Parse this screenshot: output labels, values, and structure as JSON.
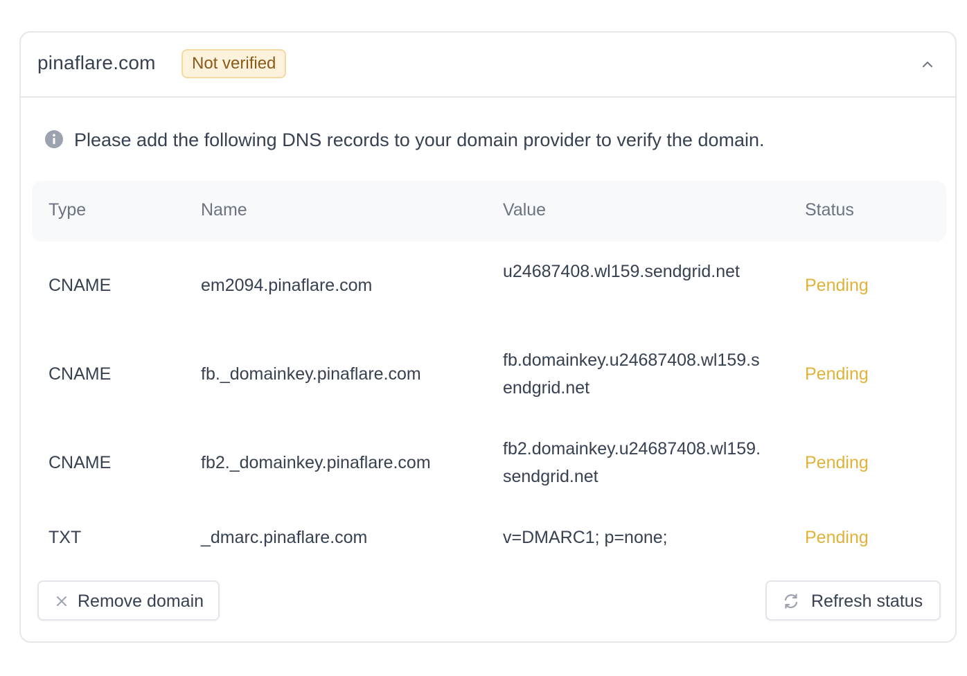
{
  "domain": {
    "name": "pinaflare.com",
    "status_badge": "Not verified"
  },
  "notice": {
    "icon": "info-icon",
    "text": "Please add the following DNS records to your domain provider to verify the domain."
  },
  "table": {
    "columns": [
      "Type",
      "Name",
      "Value",
      "Status"
    ],
    "rows": [
      {
        "type": "CNAME",
        "name": "em2094.pinaflare.com",
        "value": "u24687408.wl159.sendgrid.net",
        "status": "Pending"
      },
      {
        "type": "CNAME",
        "name": "fb._domainkey.pinaflare.com",
        "value": "fb.domainkey.u24687408.wl159.sendgrid.net",
        "status": "Pending"
      },
      {
        "type": "CNAME",
        "name": "fb2._domainkey.pinaflare.com",
        "value": "fb2.domainkey.u24687408.wl159.sendgrid.net",
        "status": "Pending"
      },
      {
        "type": "TXT",
        "name": "_dmarc.pinaflare.com",
        "value": "v=DMARC1; p=none;",
        "status": "Pending"
      }
    ]
  },
  "actions": {
    "remove_label": "Remove domain",
    "remove_icon": "close-icon",
    "refresh_label": "Refresh status",
    "refresh_icon": "refresh-icon"
  },
  "colors": {
    "badge_bg": "#fdf3dc",
    "badge_text": "#8a5a1a",
    "pending": "#e0b23a",
    "header_bg": "#f8f9fb"
  }
}
